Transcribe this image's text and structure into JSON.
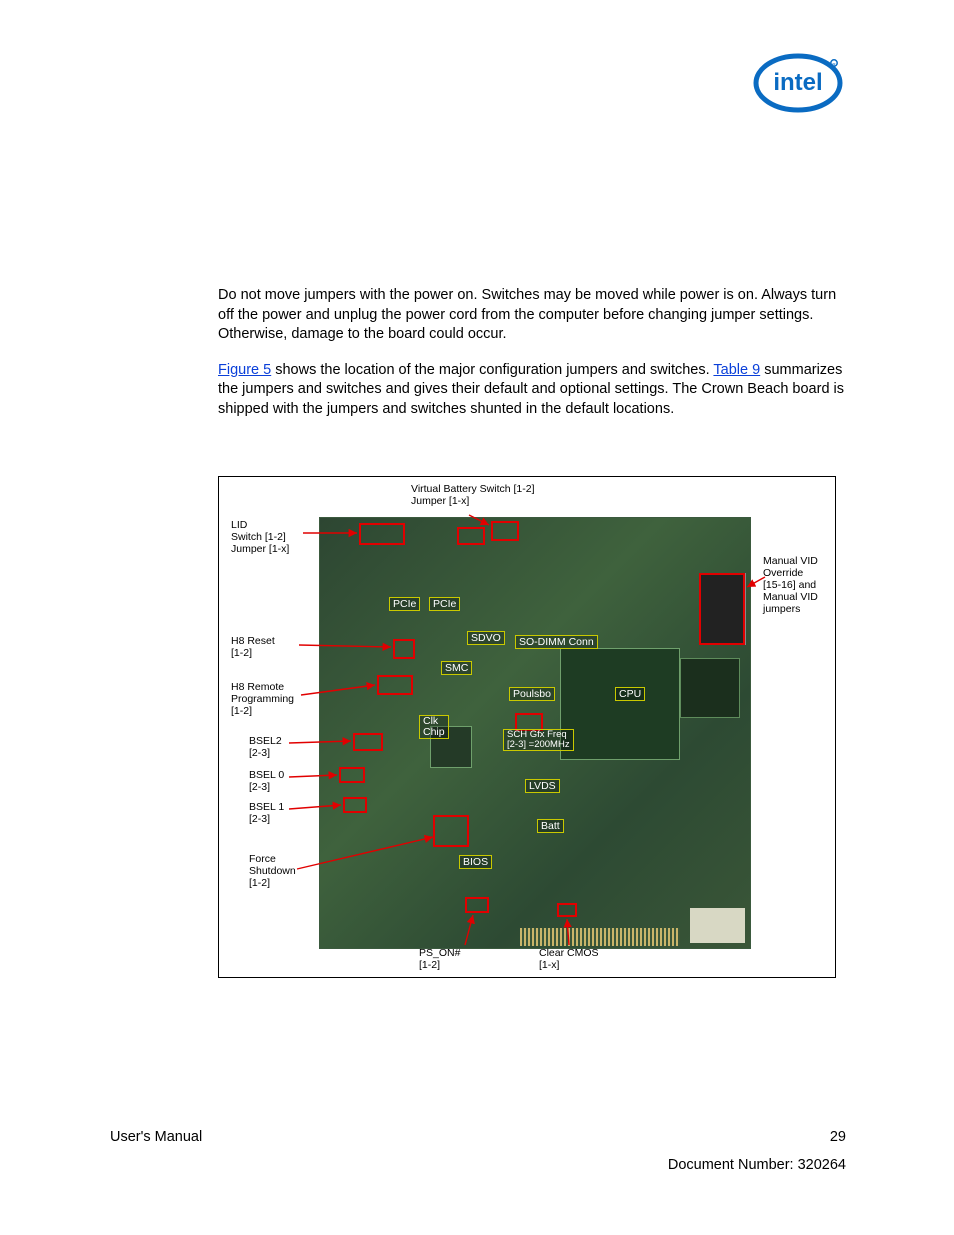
{
  "header": {
    "brand": "intel"
  },
  "paragraphs": {
    "p1": "Do not move jumpers with the power on. Switches may be moved while power is on. Always turn off the power and unplug the power cord from the computer before changing jumper settings. Otherwise, damage to the board could occur.",
    "p2a": "Figure 5",
    "p2b": " shows the location of the major configuration jumpers and switches. ",
    "p2c": "Table 9",
    "p2d": " summarizes the jumpers and switches and gives their default and optional settings. The Crown Beach board is shipped with the jumpers and switches shunted in the default locations."
  },
  "figure": {
    "top_labels": {
      "virtual_battery": "Virtual Battery Switch [1-2]\nJumper [1-x]"
    },
    "left_labels": {
      "lid": "LID\nSwitch [1-2]\nJumper [1-x]",
      "h8_reset": "H8 Reset\n[1-2]",
      "h8_remote": "H8 Remote\nProgramming\n[1-2]",
      "bsel2": "BSEL2\n[2-3]",
      "bsel0": "BSEL 0\n[2-3]",
      "bsel1": "BSEL 1\n[2-3]",
      "force_shutdown": "Force\nShutdown\n[1-2]"
    },
    "right_labels": {
      "manual_vid": "Manual VID\nOverride\n[15-16] and\nManual VID\njumpers"
    },
    "bottom_labels": {
      "ps_on": "PS_ON#\n[1-2]",
      "clear_cmos": "Clear CMOS\n[1-x]"
    },
    "board_labels": {
      "pcie1": "PCIe",
      "pcie2": "PCIe",
      "sdvo": "SDVO",
      "sodimm": "SO-DIMM Conn",
      "smc": "SMC",
      "poulsbo": "Poulsbo",
      "cpu": "CPU",
      "clk_chip": "Clk\nChip",
      "sch_gfx": "SCH Gfx Freq\n[2-3] =200MHz",
      "lvds": "LVDS",
      "batt": "Batt",
      "bios": "BIOS"
    }
  },
  "footer": {
    "left": "User's Manual",
    "page": "29",
    "docnum": "Document Number: 320264"
  }
}
